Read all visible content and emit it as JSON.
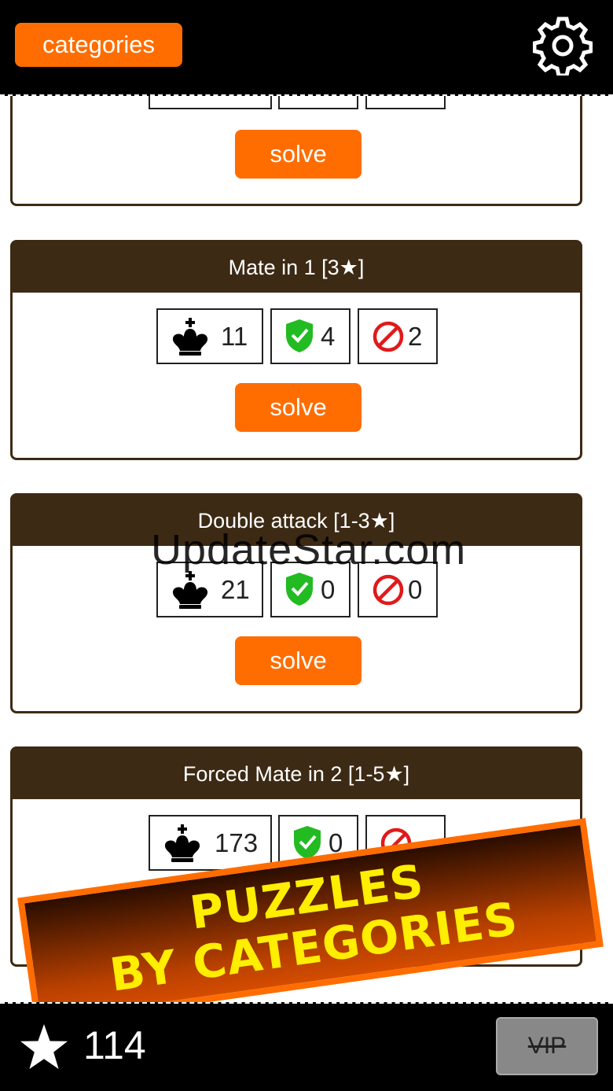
{
  "header": {
    "categories_label": "categories"
  },
  "cards": [
    {
      "title": "",
      "king_count": "",
      "solved_count": "",
      "failed_count": "",
      "solve_label": "solve"
    },
    {
      "title": "Mate in 1 [3★]",
      "king_count": "11",
      "solved_count": "4",
      "failed_count": "2",
      "solve_label": "solve"
    },
    {
      "title": "Double attack [1-3★]",
      "king_count": "21",
      "solved_count": "0",
      "failed_count": "0",
      "solve_label": "solve"
    },
    {
      "title": "Forced Mate in 2 [1-5★]",
      "king_count": "173",
      "solved_count": "0",
      "failed_count": "",
      "solve_label": ""
    }
  ],
  "watermark": "UpdateStar.com",
  "banner": {
    "line1": "PUZZLES",
    "line2": "BY CATEGORIES"
  },
  "footer": {
    "score": "114",
    "vip_label": "VIP"
  },
  "colors": {
    "accent": "#ff6d00",
    "card_header": "#3d2a14",
    "shield": "#22bb22",
    "forbidden": "#e01a1a",
    "banner_text": "#ffee00"
  },
  "icons": [
    "gear-icon",
    "king-icon",
    "shield-check-icon",
    "forbidden-icon",
    "star-icon"
  ]
}
